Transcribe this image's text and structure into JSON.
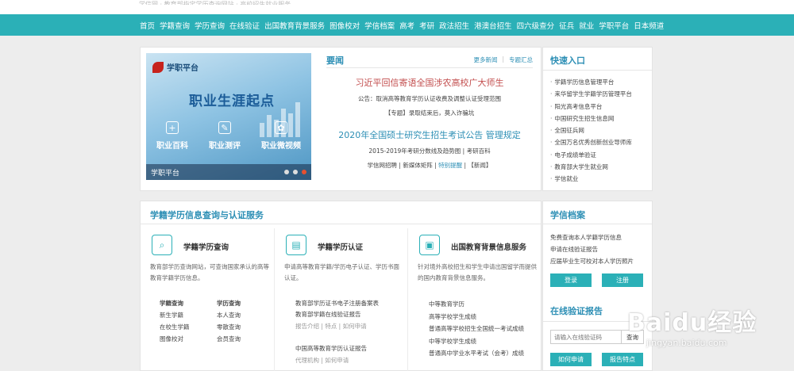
{
  "topbar": {
    "text": "学信网 · 教育部指定学历查询网站 · 高校招生就业服务"
  },
  "nav": [
    "首页",
    "学籍查询",
    "学历查询",
    "在线验证",
    "出国教育背景服务",
    "图像校对",
    "学信档案",
    "高考",
    "考研",
    "政法招生",
    "港澳台招生",
    "四六级查分",
    "征兵",
    "就业",
    "学职平台",
    "日本频道"
  ],
  "banner": {
    "logo": "学职平台",
    "title": "职业生涯起点",
    "items": [
      {
        "icon": "+",
        "label": "职业百科"
      },
      {
        "icon": "✎",
        "label": "职业测评"
      },
      {
        "icon": "✿",
        "label": "职业微视频"
      }
    ],
    "caption": "学职平台"
  },
  "news": {
    "title": "要闻",
    "more": "更多新闻",
    "topics": "专题汇总",
    "headline1": "习近平回信寄语全国涉农高校广大师生",
    "line1": "公告：取消高等教育学历认证收费及调整认证受理范围",
    "line2": "【专题】录取结束后，莫入诈骗坑",
    "headline2": "2020年全国硕士研究生招生考试公告 管理规定",
    "line3": "2015-2019年考研分数线及趋势图 | 考研百科",
    "line4_a": "学信网招聘 | 新媒体矩阵 | ",
    "line4_b": "特别提醒",
    "line4_c": " | 【新闻】"
  },
  "quick": {
    "title": "快速入口",
    "items": [
      "学籍学历信息管理平台",
      "来华留学生学籍学历管理平台",
      "阳光高考信息平台",
      "中国研究生招生信息网",
      "全国征兵网",
      "全国万名优秀创新创业导师库",
      "电子成绩单验证",
      "教育部大学生就业网",
      "学信就业"
    ]
  },
  "services": {
    "title": "学籍学历信息查询与认证服务",
    "col1": {
      "name": "学籍学历查询",
      "desc": "教育部学历查询网站，可查询国家承认的高等教育学籍学历信息。",
      "grid": [
        "学籍查询",
        "学历查询",
        "新生学籍",
        "本人查询",
        "在校生学籍",
        "零散查询",
        "图像校对",
        "会员查询"
      ]
    },
    "col2": {
      "name": "学籍学历认证",
      "desc": "申请高等教育学籍/学历电子认证、学历书面认证。",
      "links": [
        "教育部学历证书电子注册备案表",
        "教育部学籍在线验证报告"
      ],
      "sub1": "报告介绍   |   特点   |   如何申请",
      "links2": [
        "中国高等教育学历认证报告"
      ],
      "sub2": "代理机构   |   如何申请"
    },
    "col3": {
      "name": "出国教育背景信息服务",
      "desc": "针对境外高校招生和学生申请出国留学而提供的国内教育背景信息服务。",
      "links": [
        "中等教育学历",
        "高等学校学生成绩",
        "普通高等学校招生全国统一考试成绩",
        "中等学校学生成绩",
        "普通高中学业水平考试（会考）成绩"
      ]
    }
  },
  "archive": {
    "title": "学信档案",
    "items": [
      "免费查询本人学籍学历信息",
      "申请在线验证报告",
      "应届毕业生可校对本人学历照片"
    ],
    "login": "登录",
    "register": "注册"
  },
  "verify": {
    "title": "在线验证报告",
    "placeholder": "请输入在线验证码",
    "query": "查询",
    "apply": "如何申请",
    "features": "报告特点"
  },
  "watermark": {
    "big": "Baidu经验",
    "small": "jingyan.baidu.com"
  },
  "colors": {
    "nav": "#2bb0b7",
    "accent": "#2d8fb5",
    "headline": "#c24c4c"
  }
}
